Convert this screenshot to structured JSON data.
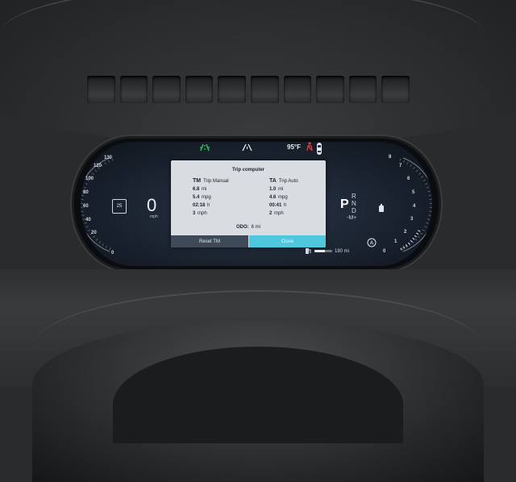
{
  "telltales": {
    "lane_icon": "lane-assist-icon",
    "road_icon": "road-icon",
    "temperature": "95°F",
    "seatbelt_icon": "seatbelt-warning-icon",
    "car_icon": "car-door-icon"
  },
  "speed_gauge": {
    "ticks": [
      "130",
      "120",
      "100",
      "80",
      "60",
      "40",
      "20",
      "0"
    ],
    "speed": "0",
    "unit": "mph",
    "speed_limit": "25"
  },
  "trip_computer": {
    "title": "Trip computer",
    "manual": {
      "code": "TM",
      "name": "Trip Manual",
      "distance": "6.8",
      "distance_unit": "mi",
      "economy": "5.4",
      "economy_unit": "mpg",
      "time": "02:18",
      "time_unit": "h",
      "avg_speed": "3",
      "avg_speed_unit": "mph"
    },
    "auto": {
      "code": "TA",
      "name": "Trip Auto",
      "distance": "1.0",
      "distance_unit": "mi",
      "economy": "4.6",
      "economy_unit": "mpg",
      "time": "00:41",
      "time_unit": "h",
      "avg_speed": "2",
      "avg_speed_unit": "mph"
    },
    "odo_label": "ODO:",
    "odo_value": "6 mi",
    "reset_label": "Reset TM",
    "close_label": "Close"
  },
  "gear_selector": {
    "active": "P",
    "gears": [
      "R",
      "N",
      "D"
    ],
    "manual": "-M+"
  },
  "rpm_gauge": {
    "ticks": [
      "8",
      "7",
      "6",
      "5",
      "4",
      "3",
      "2",
      "1",
      "0"
    ],
    "auto_hold_icon": "auto-hold-icon"
  },
  "range": {
    "icon": "fuel-pump-icon",
    "value": "180 mi"
  },
  "colors": {
    "accent": "#4fc7dd",
    "dialog_bg": "#d9dde2",
    "reset_button": "#3f4a59",
    "lane_icon": "#2ecc55",
    "warning": "#e04040"
  }
}
